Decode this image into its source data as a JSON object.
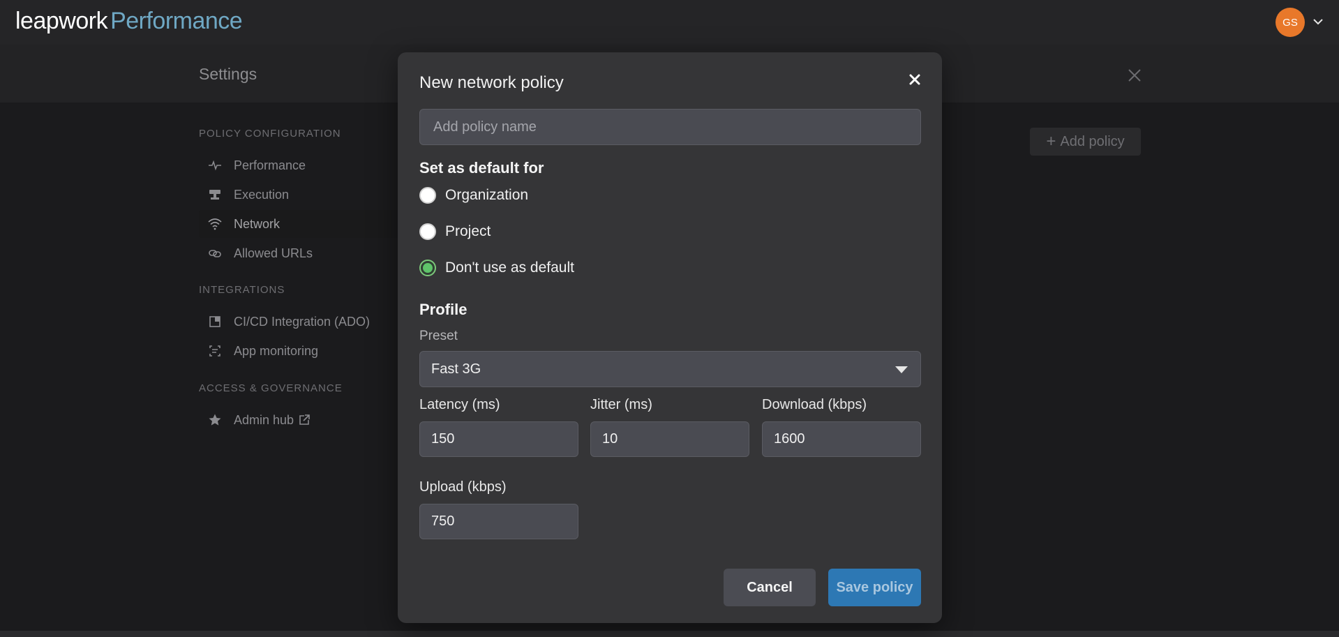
{
  "app": {
    "logo_primary": "leapwork",
    "logo_secondary": "Performance",
    "user_initials": "GS",
    "accent_color": "#e8782a"
  },
  "settings": {
    "title": "Settings",
    "sections": [
      {
        "label": "POLICY CONFIGURATION",
        "items": [
          {
            "label": "Performance",
            "icon": "pulse-icon"
          },
          {
            "label": "Execution",
            "icon": "execution-icon"
          },
          {
            "label": "Network",
            "icon": "wifi-icon",
            "active": true
          },
          {
            "label": "Allowed URLs",
            "icon": "link-icon"
          }
        ]
      },
      {
        "label": "INTEGRATIONS",
        "items": [
          {
            "label": "CI/CD Integration (ADO)",
            "icon": "integration-icon"
          },
          {
            "label": "App monitoring",
            "icon": "monitor-icon"
          }
        ]
      },
      {
        "label": "ACCESS & GOVERNANCE",
        "items": [
          {
            "label": "Admin hub",
            "icon": "star-icon"
          }
        ]
      }
    ],
    "add_policy_label": "Add policy"
  },
  "modal": {
    "title": "New network policy",
    "policy_name_placeholder": "Add policy name",
    "default_heading": "Set as default for",
    "default_options": [
      {
        "label": "Organization",
        "checked": false
      },
      {
        "label": "Project",
        "checked": false
      },
      {
        "label": "Don't use as default",
        "checked": true
      }
    ],
    "profile_heading": "Profile",
    "preset_label": "Preset",
    "preset_value": "Fast 3G",
    "latency_label": "Latency (ms)",
    "latency_value": "150",
    "jitter_label": "Jitter (ms)",
    "jitter_value": "10",
    "download_label": "Download (kbps)",
    "download_value": "1600",
    "upload_label": "Upload (kbps)",
    "upload_value": "750",
    "cancel_label": "Cancel",
    "save_label": "Save policy"
  }
}
